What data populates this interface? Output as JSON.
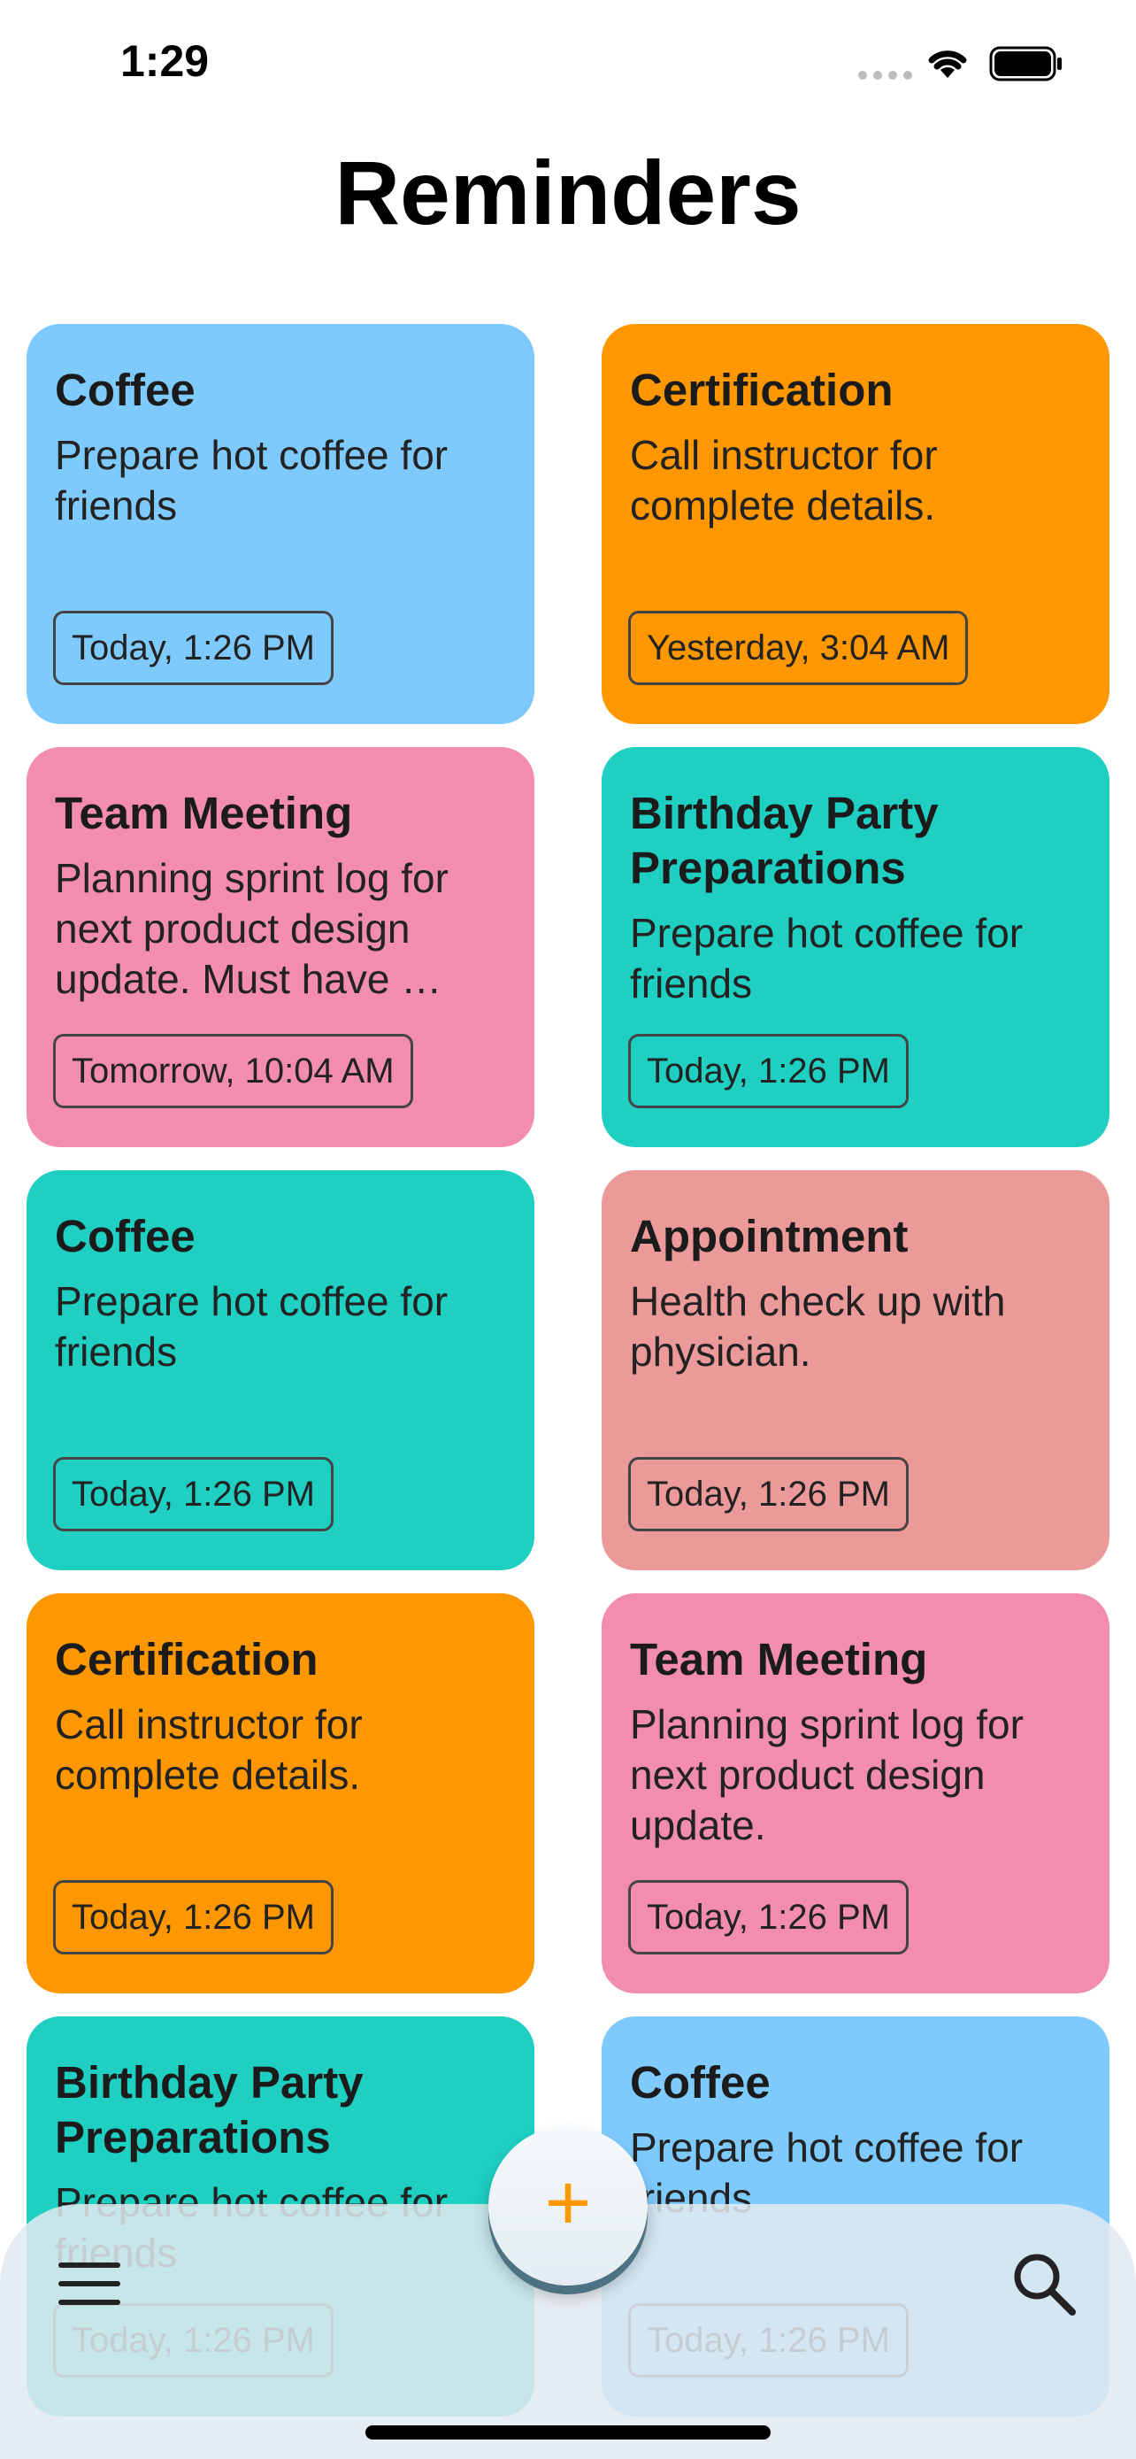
{
  "status_bar": {
    "time": "1:29"
  },
  "header": {
    "title": "Reminders"
  },
  "colors": {
    "blue": "#7fcafc",
    "orange": "#ff9800",
    "pink": "#f28daf",
    "teal": "#1ecfc2",
    "salmon": "#ec9a99"
  },
  "reminders": [
    {
      "title": "Coffee",
      "text": "Prepare hot coffee for friends",
      "time": "Today, 1:26 PM",
      "color": "#7fcafc"
    },
    {
      "title": "Certification",
      "text": "Call instructor for complete details.",
      "time": "Yesterday, 3:04 AM",
      "color": "#ff9800"
    },
    {
      "title": "Team Meeting",
      "text": "Planning sprint log for next product design update. Must have …",
      "time": "Tomorrow, 10:04 AM",
      "color": "#f28daf"
    },
    {
      "title": "Birthday Party Preparations",
      "text": "Prepare hot coffee for friends",
      "time": "Today, 1:26 PM",
      "color": "#1ecfc2"
    },
    {
      "title": "Coffee",
      "text": "Prepare hot coffee for friends",
      "time": "Today, 1:26 PM",
      "color": "#1ecfc2"
    },
    {
      "title": "Appointment",
      "text": "Health check up with physician.",
      "time": "Today, 1:26 PM",
      "color": "#ec9a99"
    },
    {
      "title": "Certification",
      "text": "Call instructor for complete details.",
      "time": "Today, 1:26 PM",
      "color": "#ff9800"
    },
    {
      "title": "Team Meeting",
      "text": "Planning sprint log for next product design update.",
      "time": "Today, 1:26 PM",
      "color": "#f28daf"
    },
    {
      "title": "Birthday Party Preparations",
      "text": "Prepare hot coffee for friends",
      "time": "Today, 1:26 PM",
      "color": "#1ecfc2"
    },
    {
      "title": "Coffee",
      "text": "Prepare hot coffee for friends",
      "time": "Today, 1:26 PM",
      "color": "#7fcafc"
    }
  ],
  "bottom_bar": {
    "menu_icon": "menu-icon",
    "add_icon": "plus-icon",
    "search_icon": "search-icon",
    "add_label": "+"
  }
}
